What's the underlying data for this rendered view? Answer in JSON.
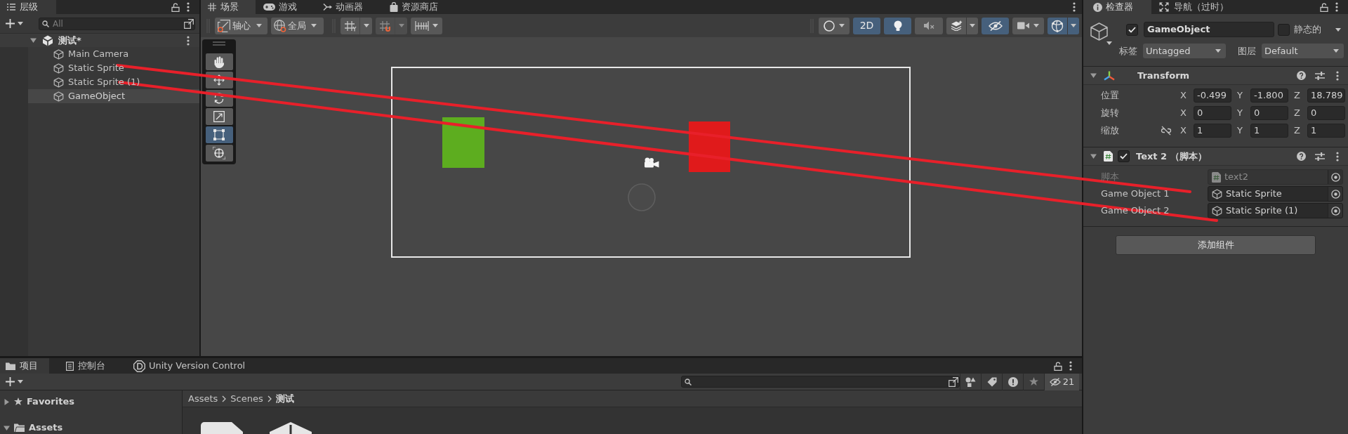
{
  "hierarchy": {
    "tabs": [
      {
        "label": "层级",
        "selected": true
      }
    ],
    "search": {
      "placeholder": "All"
    },
    "scene": {
      "name": "测试*",
      "expanded": true,
      "children": [
        {
          "name": "Main Camera",
          "selected": false
        },
        {
          "name": "Static Sprite",
          "selected": false
        },
        {
          "name": "Static Sprite (1)",
          "selected": false
        },
        {
          "name": "GameObject",
          "selected": true
        }
      ]
    }
  },
  "scene_view": {
    "tabs": [
      {
        "kind": "scene",
        "label": "场景",
        "selected": true
      },
      {
        "kind": "game",
        "label": "游戏",
        "selected": false
      },
      {
        "kind": "animator",
        "label": "动画器",
        "selected": false
      },
      {
        "kind": "store",
        "label": "资源商店",
        "selected": false
      }
    ],
    "pivot": "轴心",
    "space": "全局",
    "toggles": [
      {
        "kind": "shading",
        "on": false
      },
      {
        "kind": "dimension",
        "label": "2D",
        "on": true
      },
      {
        "kind": "lighting",
        "on": true
      },
      {
        "kind": "audio",
        "on": false
      },
      {
        "kind": "effects",
        "on": false
      },
      {
        "kind": "visibility",
        "on": true
      },
      {
        "kind": "camera",
        "on": false
      },
      {
        "kind": "gizmos",
        "on": true
      }
    ],
    "tools": [
      {
        "kind": "hand",
        "selected": false
      },
      {
        "kind": "move",
        "selected": false
      },
      {
        "kind": "rotate",
        "selected": false
      },
      {
        "kind": "scale",
        "selected": false
      },
      {
        "kind": "rect",
        "selected": true
      },
      {
        "kind": "transform",
        "selected": false
      }
    ],
    "sprites": [
      {
        "color": "#5dad1f"
      },
      {
        "color": "#e01a1b"
      }
    ]
  },
  "inspector": {
    "tabs": [
      {
        "kind": "inspector",
        "label": "检查器",
        "selected": true
      },
      {
        "kind": "navigation",
        "label": "导航（过时）",
        "selected": false
      }
    ],
    "object": {
      "active": true,
      "name": "GameObject",
      "static": false,
      "static_label": "静态的",
      "tag_label": "标签",
      "tag": "Untagged",
      "layer_label": "图层",
      "layer": "Default"
    },
    "components": [
      {
        "kind": "transform",
        "title": "Transform",
        "expanded": true,
        "scale_constrained": false,
        "rows": [
          {
            "kind": "position",
            "label": "位置",
            "fields": [
              {
                "axis": "X",
                "value": "-0.499"
              },
              {
                "axis": "Y",
                "value": "-1.800"
              },
              {
                "axis": "Z",
                "value": "18.789"
              }
            ]
          },
          {
            "kind": "rotation",
            "label": "旋转",
            "fields": [
              {
                "axis": "X",
                "value": "0"
              },
              {
                "axis": "Y",
                "value": "0"
              },
              {
                "axis": "Z",
                "value": "0"
              }
            ]
          },
          {
            "kind": "scale",
            "label": "缩放",
            "fields": [
              {
                "axis": "X",
                "value": "1"
              },
              {
                "axis": "Y",
                "value": "1"
              },
              {
                "axis": "Z",
                "value": "1"
              }
            ]
          }
        ]
      },
      {
        "kind": "script",
        "title": "Text 2 （脚本）",
        "enabled": true,
        "expanded": true,
        "fields": [
          {
            "kind": "script",
            "label": "脚本",
            "value": "text2",
            "disabled": true
          },
          {
            "kind": "object",
            "label": "Game Object 1",
            "value": "Static Sprite",
            "disabled": false
          },
          {
            "kind": "object",
            "label": "Game Object 2",
            "value": "Static Sprite (1)",
            "disabled": false
          }
        ]
      }
    ],
    "add_button": "添加组件"
  },
  "project": {
    "tabs": [
      {
        "kind": "project",
        "label": "项目",
        "selected": true
      },
      {
        "kind": "console",
        "label": "控制台",
        "selected": false
      },
      {
        "kind": "version_control",
        "label": "Unity Version Control",
        "selected": false
      }
    ],
    "hidden_count": "21",
    "tree": [
      {
        "kind": "favorites",
        "name": "Favorites",
        "expanded": false
      },
      {
        "kind": "folder",
        "name": "Assets",
        "expanded": true
      }
    ],
    "breadcrumb": [
      "Assets",
      "Scenes",
      "测试"
    ]
  }
}
